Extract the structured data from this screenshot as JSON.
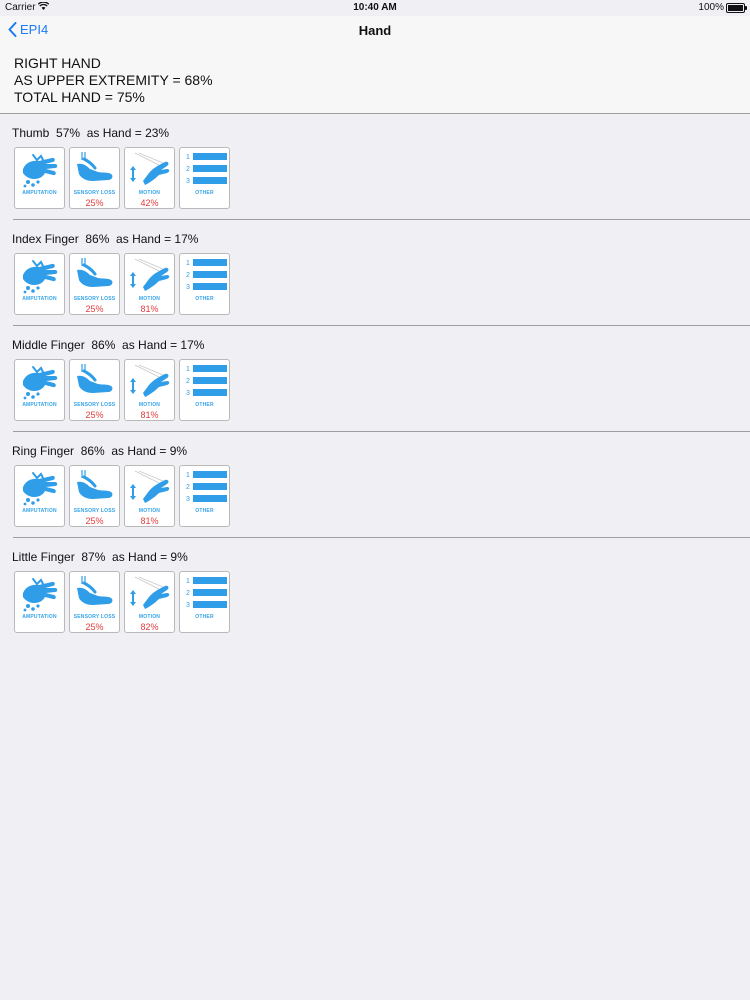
{
  "status_bar": {
    "carrier": "Carrier",
    "time": "10:40 AM",
    "battery": "100%"
  },
  "nav": {
    "back_label": "EPI4",
    "title": "Hand"
  },
  "summary": {
    "line1": "RIGHT HAND",
    "line2": "AS UPPER EXTREMITY = 68%",
    "line3": "TOTAL HAND = 75%"
  },
  "tile_labels": {
    "amputation": "AMPUTATION",
    "sensory": "SENSORY LOSS",
    "motion": "MOTION",
    "other": "OTHER"
  },
  "other_numbers": [
    "1",
    "2",
    "3"
  ],
  "colors": {
    "icon_blue": "#2f9de8",
    "percent_red": "#e23c3c",
    "accent": "#1a7cf5"
  },
  "sections": [
    {
      "heading": "Thumb  57%  as Hand = 23%",
      "sensory_pct": "25%",
      "motion_pct": "42%"
    },
    {
      "heading": "Index Finger  86%  as Hand = 17%",
      "sensory_pct": "25%",
      "motion_pct": "81%"
    },
    {
      "heading": "Middle Finger  86%  as Hand = 17%",
      "sensory_pct": "25%",
      "motion_pct": "81%"
    },
    {
      "heading": "Ring Finger  86%  as Hand = 9%",
      "sensory_pct": "25%",
      "motion_pct": "81%"
    },
    {
      "heading": "Little Finger  87%  as Hand = 9%",
      "sensory_pct": "25%",
      "motion_pct": "82%"
    }
  ]
}
